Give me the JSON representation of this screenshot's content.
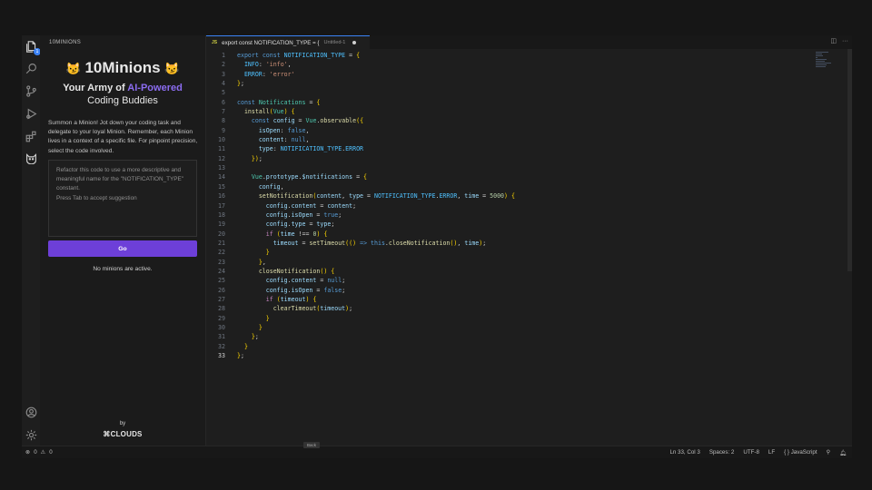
{
  "sidebar": {
    "title": "10MINIONS",
    "brand": "10Minions",
    "brand_icon": "😼",
    "tagline_prefix": "Your Army of ",
    "tagline_ai": "AI-Powered",
    "tagline_suffix": "Coding Buddies",
    "intro": "Summon a Minion! Jot down your coding task and delegate to your loyal Minion. Remember, each Minion lives in a context of a specific file. For pinpoint precision, select the code involved.",
    "prompt_text": "Refactor this code to use a more descriptive and meaningful name for the \"NOTIFICATION_TYPE\" constant.",
    "prompt_hint": "Press Tab to accept suggestion",
    "go_label": "Go",
    "no_minions": "No minions are active.",
    "by": "by",
    "company": "⌘CLOUDS"
  },
  "editor": {
    "tab_lang": "JS",
    "tab_name": "export const NOTIFICATION_TYPE = {",
    "tab_desc": "Untitled-1",
    "split_icon": "split-editor-icon",
    "more_icon": "more-actions-icon"
  },
  "status": {
    "errors": "0",
    "warnings": "0",
    "position": "Ln 33, Col 3",
    "spaces": "Spaces: 2",
    "encoding": "UTF-8",
    "eol": "LF",
    "language": "{ } JavaScript",
    "tooltip": "Back"
  },
  "colors": {
    "accent": "#6d3fd8",
    "brand_purple": "#8b6cf0",
    "tab_indicator": "#3b82f6"
  },
  "code": [
    "export const NOTIFICATION_TYPE = {",
    "  INFO: 'info',",
    "  ERROR: 'error'",
    "};",
    "",
    "const Notifications = {",
    "  install(Vue) {",
    "    const config = Vue.observable({",
    "      isOpen: false,",
    "      content: null,",
    "      type: NOTIFICATION_TYPE.ERROR",
    "    });",
    "",
    "    Vue.prototype.$notifications = {",
    "      config,",
    "      setNotification(content, type = NOTIFICATION_TYPE.ERROR, time = 5000) {",
    "        config.content = content;",
    "        config.isOpen = true;",
    "        config.type = type;",
    "        if (time !== 0) {",
    "          timeout = setTimeout(() => this.closeNotification(), time);",
    "        }",
    "      },",
    "      closeNotification() {",
    "        config.content = null;",
    "        config.isOpen = false;",
    "        if (timeout) {",
    "          clearTimeout(timeout);",
    "        }",
    "      }",
    "    };",
    "  }",
    "};"
  ],
  "current_line": 33
}
